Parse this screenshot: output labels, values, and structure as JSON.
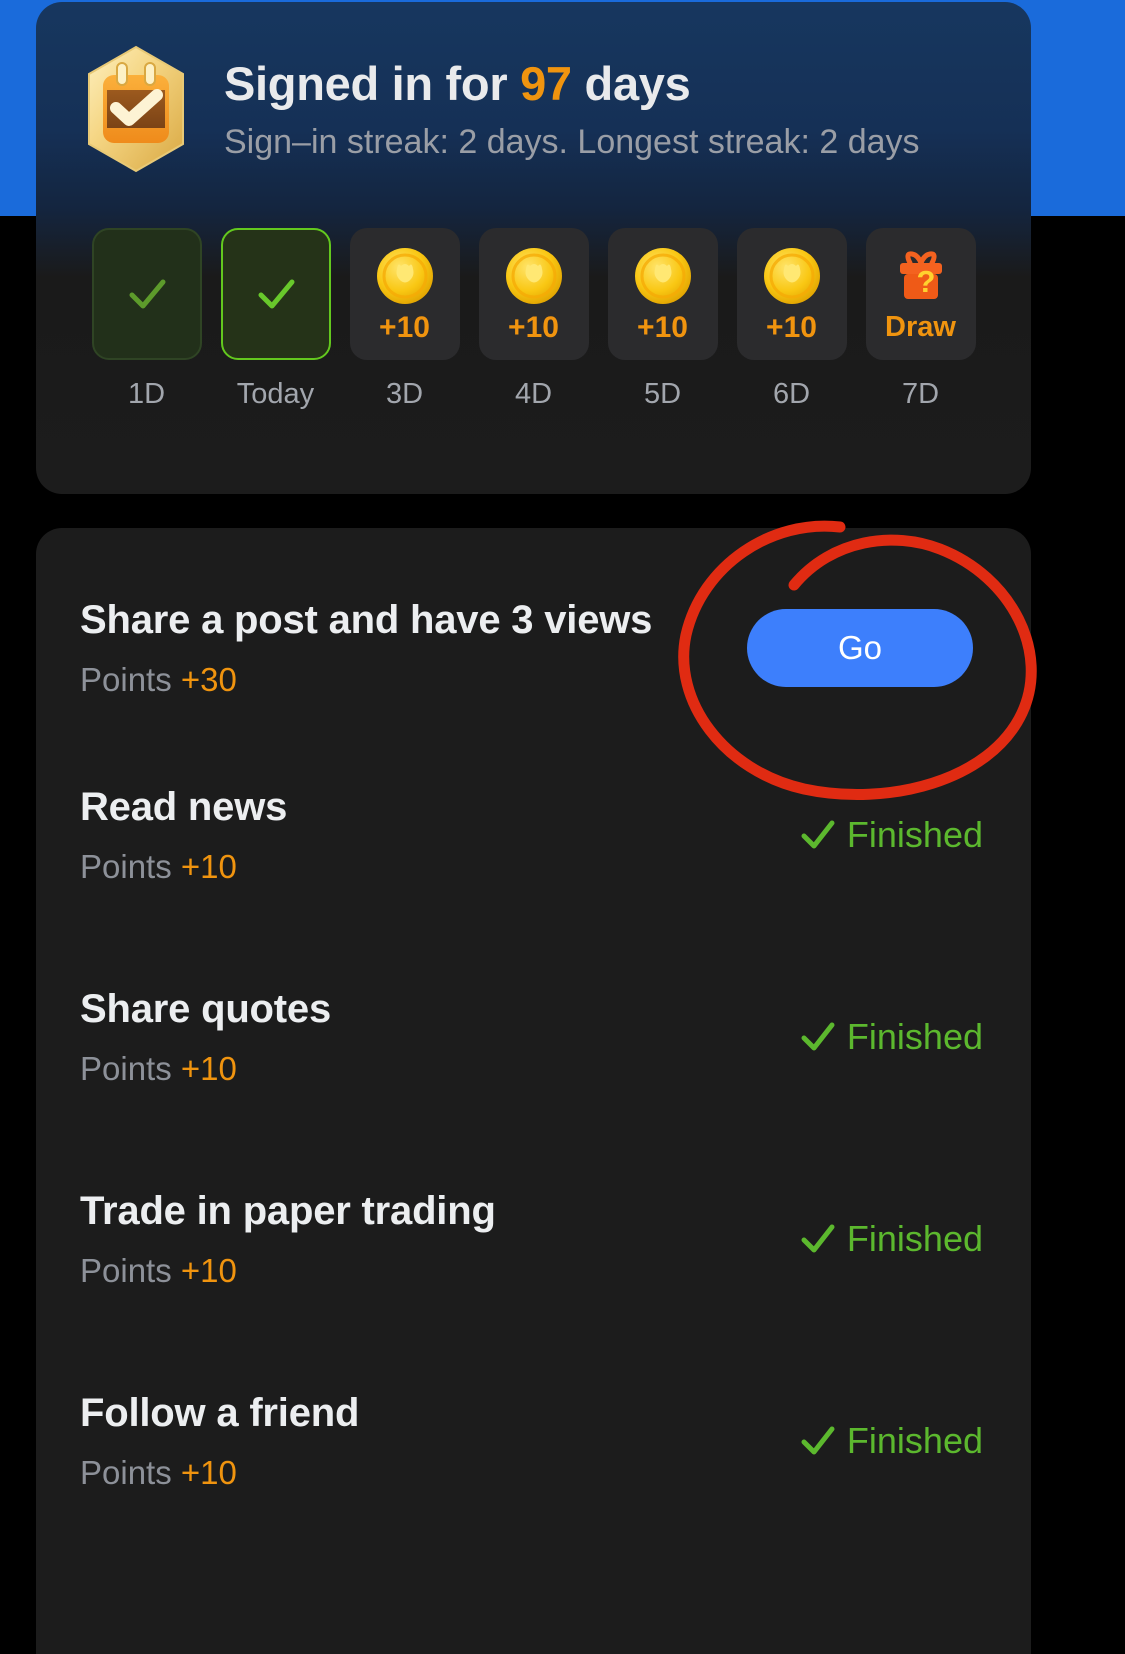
{
  "header": {
    "badge_icon": "calendar-check-badge-icon",
    "title_prefix": "Signed in for",
    "days_count": "97",
    "title_suffix": "days",
    "subtitle": "Sign–in streak: 2 days. Longest streak: 2 days"
  },
  "days": [
    {
      "label": "1D",
      "state": "claimed",
      "icon": "check-icon",
      "reward": ""
    },
    {
      "label": "Today",
      "state": "today",
      "icon": "check-icon",
      "reward": ""
    },
    {
      "label": "3D",
      "state": "pending",
      "icon": "coin-icon",
      "reward": "+10"
    },
    {
      "label": "4D",
      "state": "pending",
      "icon": "coin-icon",
      "reward": "+10"
    },
    {
      "label": "5D",
      "state": "pending",
      "icon": "coin-icon",
      "reward": "+10"
    },
    {
      "label": "6D",
      "state": "pending",
      "icon": "coin-icon",
      "reward": "+10"
    },
    {
      "label": "7D",
      "state": "pending",
      "icon": "gift-box-icon",
      "reward": "Draw"
    }
  ],
  "tasks": [
    {
      "title": "Share a post and have 3 views",
      "points_label": "Points",
      "points_value": "+30",
      "action_type": "button",
      "action_label": "Go"
    },
    {
      "title": "Read news",
      "points_label": "Points",
      "points_value": "+10",
      "action_type": "status",
      "action_label": "Finished"
    },
    {
      "title": "Share quotes",
      "points_label": "Points",
      "points_value": "+10",
      "action_type": "status",
      "action_label": "Finished"
    },
    {
      "title": "Trade in paper trading",
      "points_label": "Points",
      "points_value": "+10",
      "action_type": "status",
      "action_label": "Finished"
    },
    {
      "title": "Follow a friend",
      "points_label": "Points",
      "points_value": "+10",
      "action_type": "status",
      "action_label": "Finished"
    }
  ],
  "colors": {
    "banner_blue": "#1a6bdb",
    "accent_orange": "#f0940f",
    "finished_green": "#5cb82e",
    "today_border_green": "#63c81e",
    "go_button_blue": "#3d7ffc",
    "annotation_red": "#e02b12",
    "card_dark": "#1c1c1c"
  },
  "annotation": {
    "shape": "hand-drawn-red-ellipse",
    "target": "Go"
  }
}
